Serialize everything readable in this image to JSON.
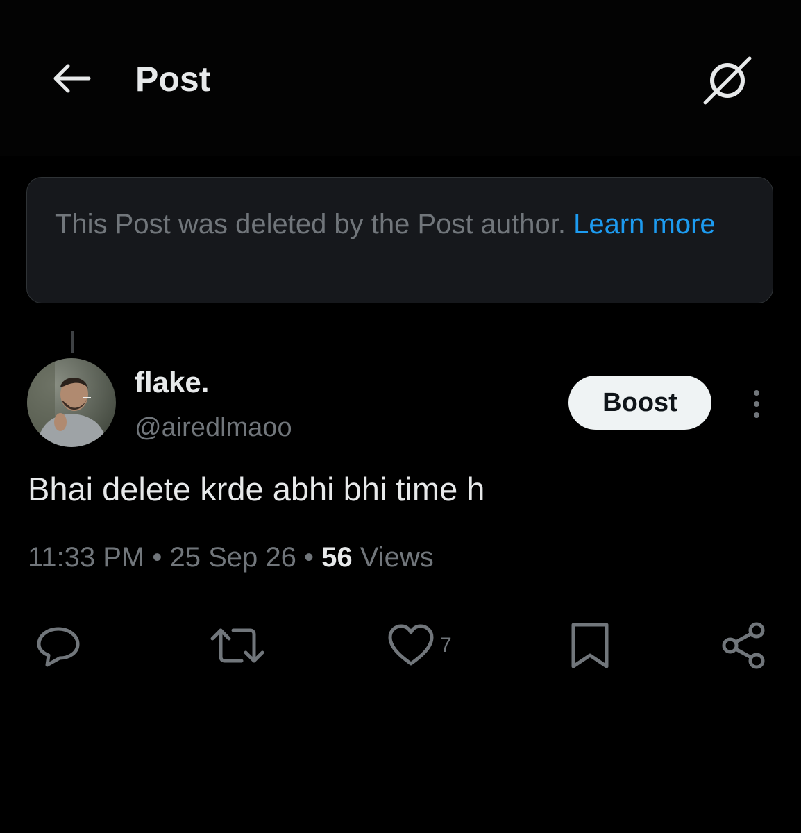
{
  "header": {
    "title": "Post",
    "back_icon": "arrow-left-icon",
    "grok_icon": "grok-icon"
  },
  "deleted_notice": {
    "text": "This Post was deleted by the Post author. ",
    "link_label": "Learn more"
  },
  "post": {
    "display_name": "flake.",
    "handle": "@airedlmaoo",
    "boost_label": "Boost",
    "text": "Bhai delete krde abhi bhi time h",
    "time": "11:33 PM",
    "separator": " • ",
    "date": "25 Sep 26",
    "views_count": "56",
    "views_label": " Views"
  },
  "actions": {
    "reply_icon": "reply-icon",
    "repost_icon": "repost-icon",
    "like_icon": "heart-icon",
    "like_count": "7",
    "bookmark_icon": "bookmark-icon",
    "share_icon": "share-icon"
  },
  "colors": {
    "background": "#000000",
    "text_primary": "#e7e9ea",
    "text_secondary": "#71767b",
    "link": "#1d9bf0",
    "notice_bg": "#16181c",
    "border": "#2f3336",
    "button_bg": "#eff3f4"
  }
}
